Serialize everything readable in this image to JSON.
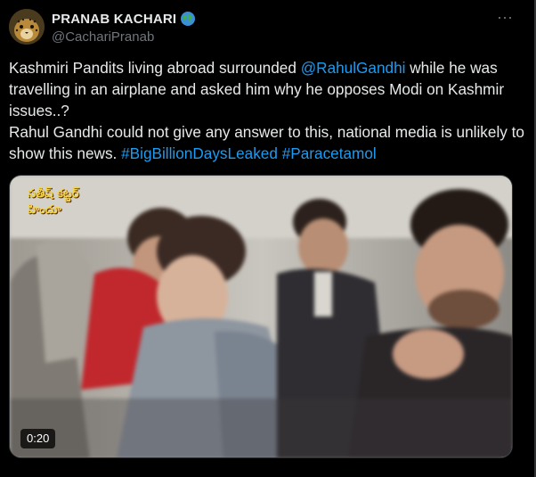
{
  "author": {
    "display_name": "PRANAB KACHARI",
    "handle": "@CachariPranab",
    "avatar_icon": "leopard-avatar",
    "badge_icon": "globe-icon"
  },
  "menu": {
    "more_label": "···"
  },
  "tweet": {
    "text_before_mention": "Kashmiri Pandits living abroad surrounded ",
    "mention": "@RahulGandhi",
    "text_after_mention": " while he was travelling in an airplane and asked him why he opposes Modi on Kashmir issues..?",
    "line2": "Rahul Gandhi could not give any answer to this, national media is unlikely to show this news. ",
    "hashtags": [
      "#BigBillionDaysLeaked",
      "#Paracetamol"
    ]
  },
  "video": {
    "duration": "0:20",
    "channel_logo_line1": "సతీష్ కట్టర్",
    "channel_logo_line2": "హిందూ"
  },
  "colors": {
    "background": "#000000",
    "text": "#e7e9ea",
    "secondary": "#71767b",
    "link": "#1d9bf0",
    "border": "#2f3336"
  }
}
